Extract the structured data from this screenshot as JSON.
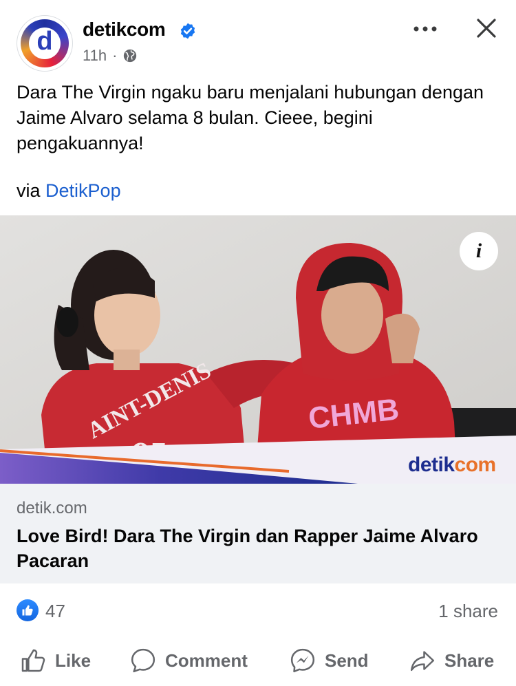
{
  "header": {
    "page_name": "detikcom",
    "avatar_letter": "d",
    "time": "11h",
    "separator": "·",
    "verified_icon": "verified-badge-icon",
    "privacy_icon": "globe-icon",
    "more_icon": "more-horizontal-icon",
    "close_icon": "close-icon"
  },
  "post": {
    "text": "Dara The Virgin ngaku baru menjalani hubungan dengan Jaime Alvaro selama 8 bulan. Cieee, begini pengakuannya!",
    "via_prefix": "via ",
    "via_link": "DetikPop"
  },
  "image": {
    "info_label": "i",
    "watermark_part1": "detik",
    "watermark_part2": "com",
    "sweatshirt_text_1": "AINT-DENIS",
    "sweatshirt_number": "95",
    "sweatshirt_text_2": "CHMB"
  },
  "link_card": {
    "domain": "detik.com",
    "headline": "Love Bird! Dara The Virgin dan Rapper Jaime Alvaro Pacaran"
  },
  "reactions": {
    "like_count": "47",
    "share_count": "1 share"
  },
  "actions": [
    {
      "label": "Like",
      "icon": "thumbs-up-icon"
    },
    {
      "label": "Comment",
      "icon": "comment-icon"
    },
    {
      "label": "Send",
      "icon": "messenger-icon"
    },
    {
      "label": "Share",
      "icon": "share-arrow-icon"
    }
  ],
  "colors": {
    "link": "#1b5fcf",
    "secondary_text": "#65676b",
    "card_bg": "#f0f2f5",
    "like_blue": "#1877f2",
    "brand_navy": "#1d2d8f",
    "brand_orange": "#e8712a"
  }
}
